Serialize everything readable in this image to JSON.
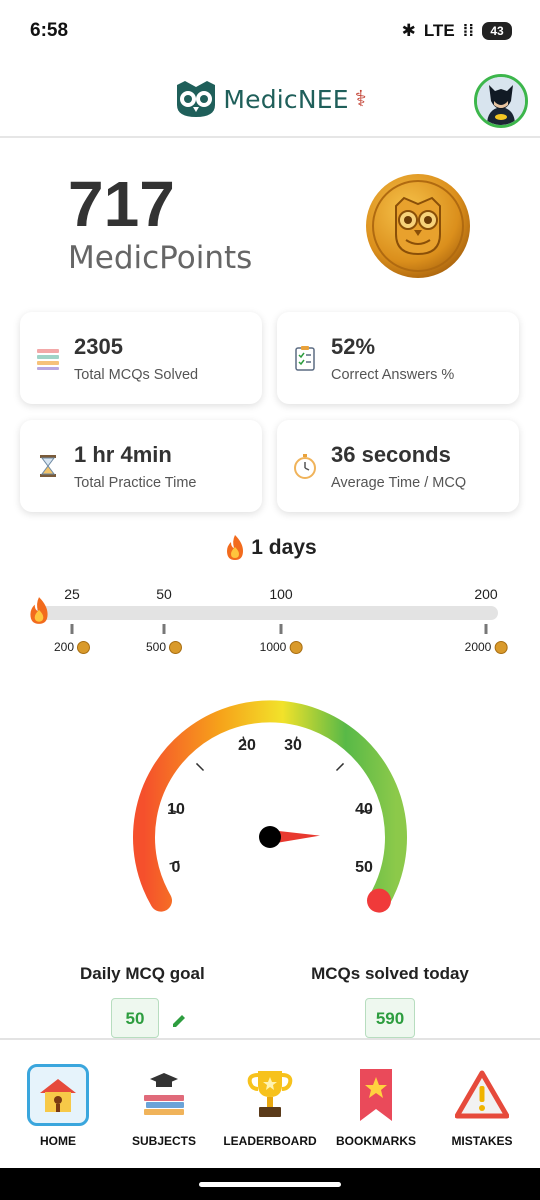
{
  "status_bar": {
    "time": "6:58",
    "network": "LTE",
    "battery": "43"
  },
  "header": {
    "app_name": "MedicNEE"
  },
  "points": {
    "value": "717",
    "label": "MedicPoints"
  },
  "stats": [
    {
      "value": "2305",
      "label": "Total MCQs Solved",
      "icon": "books-icon"
    },
    {
      "value": "52%",
      "label": "Correct Answers %",
      "icon": "clipboard-check-icon"
    },
    {
      "value": "1 hr 4min",
      "label": "Total Practice Time",
      "icon": "hourglass-icon"
    },
    {
      "value": "36 seconds",
      "label": "Average Time / MCQ",
      "icon": "stopwatch-icon"
    }
  ],
  "streak": {
    "text": "1 days",
    "icon": "fire-icon"
  },
  "milestones": {
    "progress": 0.0,
    "days": [
      "25",
      "50",
      "100",
      "200"
    ],
    "rewards": [
      "200",
      "500",
      "1000",
      "2000"
    ]
  },
  "gauge": {
    "labels": [
      "0",
      "10",
      "20",
      "30",
      "40",
      "50"
    ],
    "min": 0,
    "max": 50,
    "value": 50
  },
  "goals": {
    "daily_title": "Daily MCQ goal",
    "daily_value": "50",
    "solved_title": "MCQs solved today",
    "solved_value": "590"
  },
  "nav": [
    {
      "label": "HOME",
      "icon": "home-icon",
      "active": true
    },
    {
      "label": "SUBJECTS",
      "icon": "graduation-books-icon",
      "active": false
    },
    {
      "label": "LEADERBOARD",
      "icon": "trophy-icon",
      "active": false
    },
    {
      "label": "BOOKMARKS",
      "icon": "bookmark-star-icon",
      "active": false
    },
    {
      "label": "MISTAKES",
      "icon": "warning-icon",
      "active": false
    }
  ],
  "colors": {
    "brand": "#1f5f5a",
    "accent_green": "#3cb64b",
    "gauge_red": "#f03a3a",
    "coin": "#d99a2b",
    "active_nav": "#3aa6dd"
  }
}
